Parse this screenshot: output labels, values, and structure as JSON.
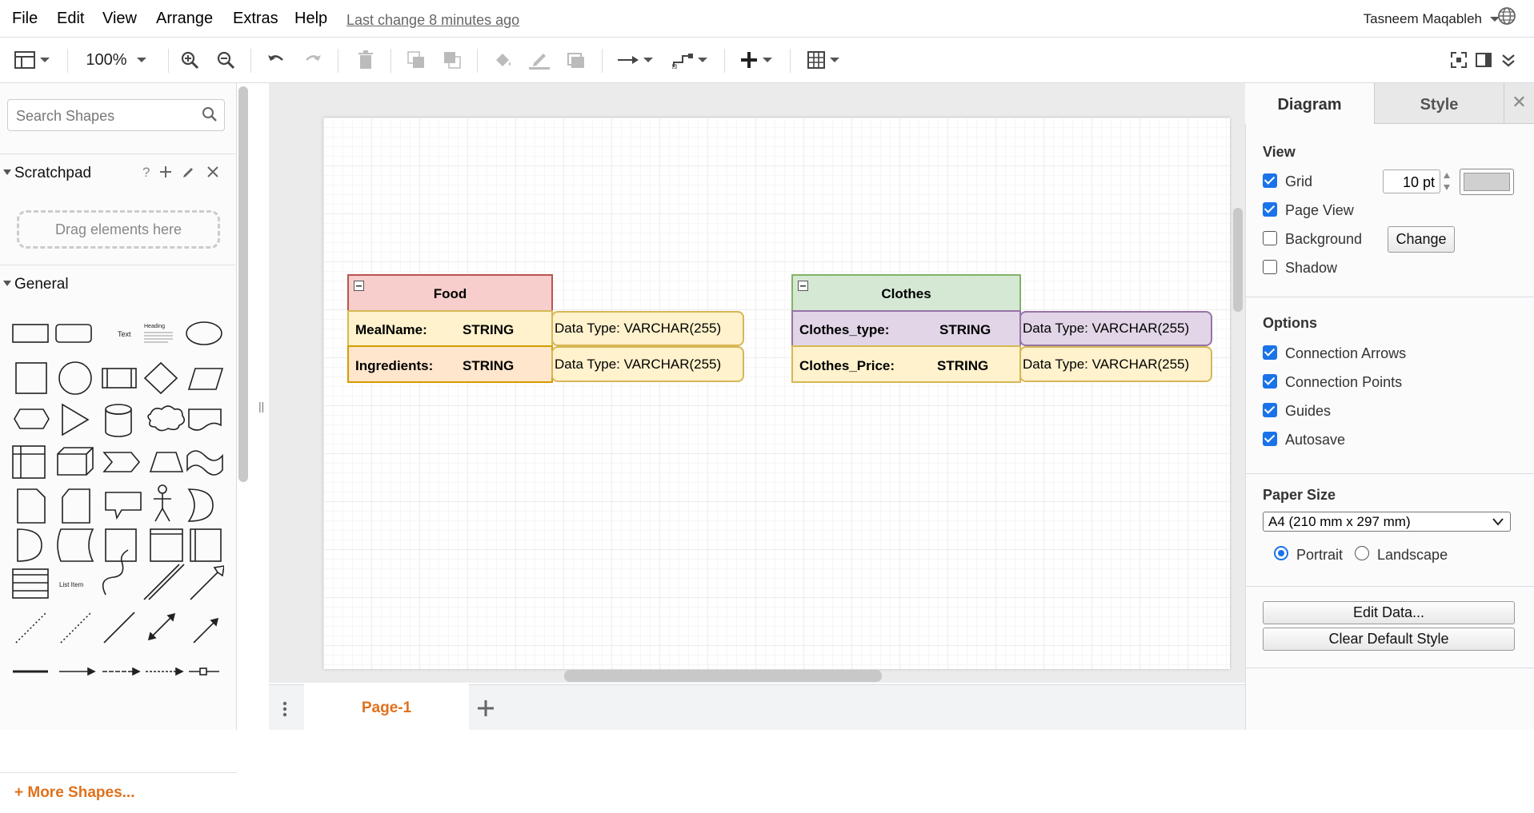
{
  "menubar": {
    "items": [
      "File",
      "Edit",
      "View",
      "Arrange",
      "Extras",
      "Help"
    ],
    "last_change": "Last change 8 minutes ago",
    "user": "Tasneem Maqableh"
  },
  "toolbar": {
    "zoom": "100%"
  },
  "left_panel": {
    "search_placeholder": "Search Shapes",
    "scratchpad_title": "Scratchpad",
    "scratchpad_help": "?",
    "drag_hint": "Drag elements here",
    "general_title": "General",
    "shape_text_label": "Text",
    "shape_heading_label": "Heading",
    "shape_list_item_label": "List Item",
    "more_shapes": "+ More Shapes..."
  },
  "diagram": {
    "food": {
      "title": "Food",
      "rows": [
        {
          "name": "MealName:",
          "type": "STRING",
          "ext": "Data Type: VARCHAR(255)"
        },
        {
          "name": "Ingredients:",
          "type": "STRING",
          "ext": "Data Type: VARCHAR(255)"
        }
      ]
    },
    "clothes": {
      "title": "Clothes",
      "rows": [
        {
          "name": "Clothes_type:",
          "type": "STRING",
          "ext": "Data Type: VARCHAR(255)"
        },
        {
          "name": "Clothes_Price:",
          "type": "STRING",
          "ext": "Data Type: VARCHAR(255)"
        }
      ]
    },
    "colors": {
      "food_header": "#f8cecc",
      "food_border": "#b85450",
      "row_yellow": "#fff2cc",
      "row_orange": "#ffe6cc",
      "row_border": "#d6b656",
      "clothes_header": "#d5e8d4",
      "clothes_border": "#82b366",
      "row_purple": "#e1d5e7",
      "purple_border": "#9673a6"
    }
  },
  "page_tab": "Page-1",
  "right_panel": {
    "tab_diagram": "Diagram",
    "tab_style": "Style",
    "view_title": "View",
    "grid_label": "Grid",
    "grid_size": "10 pt",
    "page_view_label": "Page View",
    "background_label": "Background",
    "change_button": "Change",
    "shadow_label": "Shadow",
    "options_title": "Options",
    "connection_arrows": "Connection Arrows",
    "connection_points": "Connection Points",
    "guides": "Guides",
    "autosave": "Autosave",
    "paper_size_title": "Paper Size",
    "paper_size_value": "A4 (210 mm x 297 mm)",
    "portrait": "Portrait",
    "landscape": "Landscape",
    "edit_data": "Edit Data...",
    "clear_default_style": "Clear Default Style"
  }
}
